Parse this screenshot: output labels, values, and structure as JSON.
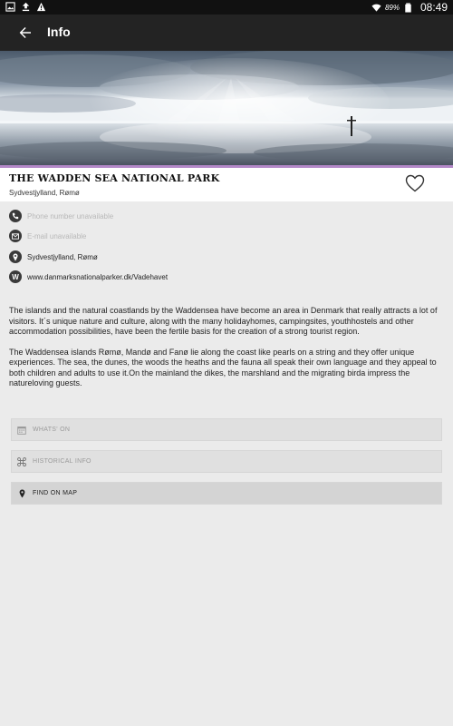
{
  "status_bar": {
    "battery": "89%",
    "time": "08:49"
  },
  "app_bar": {
    "title": "Info"
  },
  "place": {
    "title": "THE WADDEN SEA NATIONAL PARK",
    "subtitle": "Sydvestjylland, Rømø"
  },
  "info": {
    "phone": "Phone number unavailable",
    "email": "E-mail unavailable",
    "address": "Sydvestjylland, Rømø",
    "website": "www.danmarksnationalparker.dk/Vadehavet",
    "website_icon_letter": "W"
  },
  "description": {
    "p1": "The islands and the natural coastlands by the Waddensea have become an area in Denmark that really attracts a lot of visitors. It´s unique nature and culture, along with the many holidayhomes, campingsites, youthhostels and other accommodation possibilities, have been the fertile basis for the creation of a strong tourist region.",
    "p2": "The Waddensea islands Rømø, Mandø and Fanø lie along the coast like pearls on a string and they offer unique experiences. The sea, the dunes, the woods the heaths and the fauna all speak their own language and they appeal to both children and adults to use it.On the mainland the dikes, the marshland and the migrating birda impress the natureloving guests."
  },
  "actions": {
    "whats_on": "WHATS' ON",
    "historical_info": "HISTORICAL INFO",
    "find_on_map": "FIND ON MAP"
  },
  "colors": {
    "app_bar": "#232323",
    "accent_strip": "#b388c8",
    "background": "#ebebeb"
  }
}
